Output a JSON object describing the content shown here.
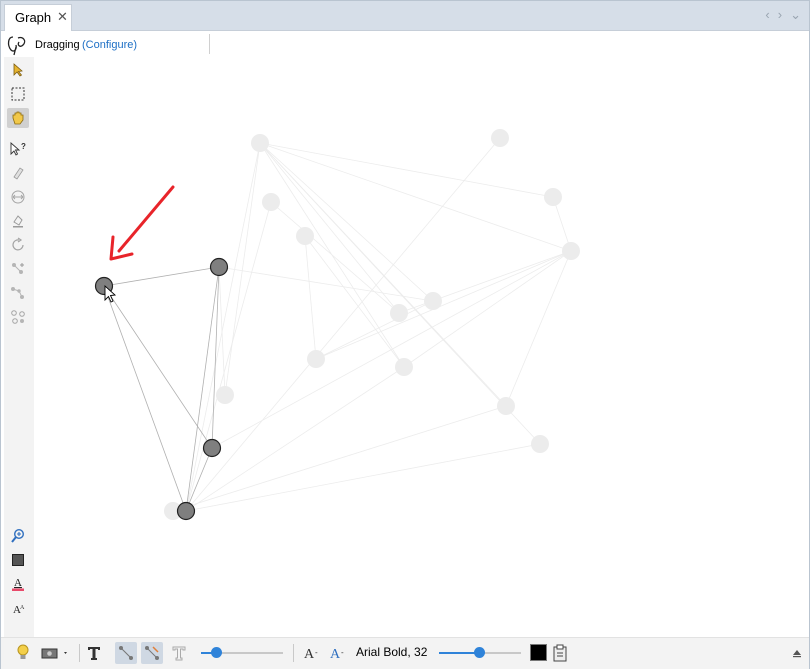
{
  "window": {
    "tab_label": "Graph",
    "tab_close": "✕",
    "nav_back": "‹",
    "nav_forward": "›",
    "nav_menu": "⌄"
  },
  "header": {
    "logo": "gephi-logo-icon",
    "mode_label": "Dragging",
    "configure_link": "(Configure)"
  },
  "left_toolbar": [
    {
      "name": "select-arrow-icon"
    },
    {
      "name": "rectangle-select-icon"
    },
    {
      "name": "drag-hand-icon",
      "selected": true
    },
    {
      "name": "edit-node-icon"
    },
    {
      "name": "painter-icon"
    },
    {
      "name": "size-icon"
    },
    {
      "name": "heat-bucket-icon"
    },
    {
      "name": "rotate-icon"
    },
    {
      "name": "add-edge-icon"
    },
    {
      "name": "shortest-path-icon"
    },
    {
      "name": "graph-neighbors-icon"
    },
    {
      "name": "zoom-icon"
    },
    {
      "name": "background-color-icon"
    },
    {
      "name": "label-color-icon"
    },
    {
      "name": "font-size-icon"
    }
  ],
  "bottom_toolbar": {
    "font_label": "Arial Bold, 32",
    "edge_thickness_level": 0.2,
    "label_size_level": 0.52,
    "label_color": "#000000"
  },
  "graph": {
    "active_node_color": "#7f7f7f",
    "faded_node_color": "#ececec",
    "annotation_arrow_color": "#e8242a"
  }
}
